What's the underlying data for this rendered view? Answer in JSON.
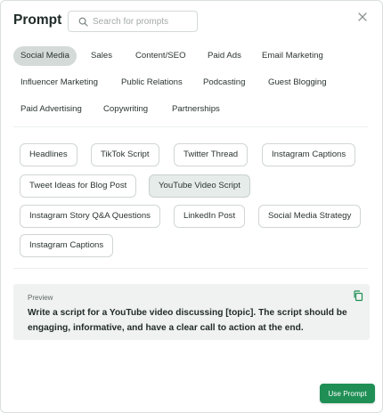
{
  "header": {
    "title": "Prompt",
    "search_placeholder": "Search for prompts"
  },
  "categories": [
    {
      "label": "Social Media",
      "active": true
    },
    {
      "label": "Sales"
    },
    {
      "label": "Content/SEO"
    },
    {
      "label": "Paid Ads"
    },
    {
      "label": "Email Marketing"
    },
    {
      "label": "Influencer Marketing"
    },
    {
      "label": "Public Relations"
    },
    {
      "label": "Podcasting"
    },
    {
      "label": "Guest Blogging"
    },
    {
      "label": "Paid Advertising"
    },
    {
      "label": "Copywriting"
    },
    {
      "label": "Partnerships"
    }
  ],
  "templates": [
    {
      "label": "Headlines"
    },
    {
      "label": "TikTok Script"
    },
    {
      "label": "Twitter Thread"
    },
    {
      "label": "Instagram Captions"
    },
    {
      "label": "Tweet Ideas for Blog Post"
    },
    {
      "label": "YouTube Video Script",
      "active": true
    },
    {
      "label": "Instagram Story Q&A Questions"
    },
    {
      "label": "LinkedIn Post"
    },
    {
      "label": "Social Media Strategy"
    },
    {
      "label": "Instagram Captions"
    }
  ],
  "preview": {
    "label": "Preview",
    "text": "Write a script for a YouTube video discussing [topic]. The script should be engaging, informative, and have a clear call to action at the end."
  },
  "footer": {
    "use_label": "Use Prompt"
  },
  "colors": {
    "accent": "#1f8f55",
    "active_chip": "#d4dad8",
    "preview_bg": "#f0f2f1"
  }
}
